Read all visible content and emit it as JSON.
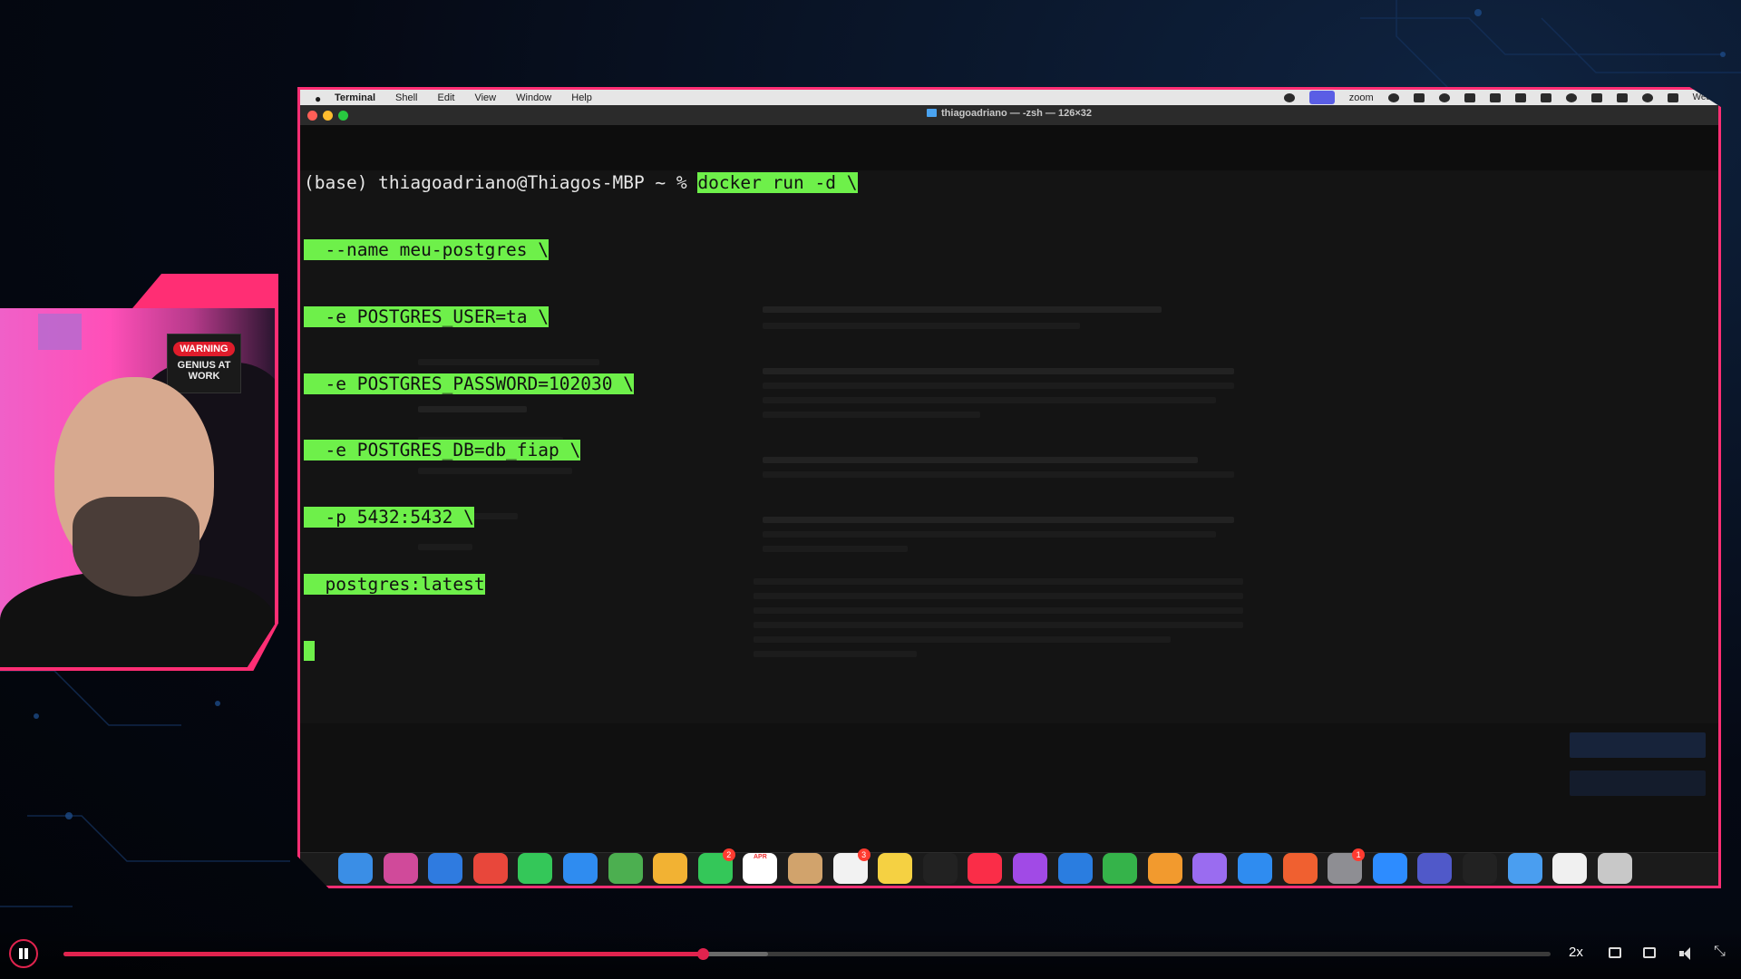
{
  "menubar": {
    "app_name": "Terminal",
    "menus": [
      "Shell",
      "Edit",
      "View",
      "Window",
      "Help"
    ],
    "zoom_label": "zoom",
    "date_fragment": "Wed"
  },
  "terminal": {
    "window_title": "thiagoadriano — -zsh — 126×32",
    "prompt": "(base) thiagoadriano@Thiagos-MBP ~ % ",
    "command_lines": [
      "docker run -d \\",
      "  --name meu-postgres \\",
      "  -e POSTGRES_USER=ta \\",
      "  -e POSTGRES_PASSWORD=102030 \\",
      "  -e POSTGRES_DB=db_fiap \\",
      "  -p 5432:5432 \\",
      "  postgres:latest"
    ]
  },
  "dock": {
    "apps": [
      "finder",
      "launchpad",
      "safari",
      "chrome",
      "messages",
      "mail",
      "maps",
      "photos",
      "facetime",
      "calendar",
      "contacts",
      "reminders",
      "notes",
      "tv",
      "music",
      "podcasts",
      "keynote",
      "numbers",
      "pages",
      "feather",
      "app-store",
      "toolbox",
      "system-settings",
      "zoom",
      "teams",
      "terminal",
      "downloads",
      "documents",
      "trash"
    ],
    "calendar_month": "APR",
    "badges": {
      "facetime": "2",
      "reminders": "3",
      "system-settings": "1"
    }
  },
  "webcam": {
    "poster_label": "WARNING",
    "poster_text": "GENIUS AT WORK"
  },
  "player": {
    "playback_speed": "2x",
    "progress_fraction": 0.43,
    "buffered_fraction": 0.474
  },
  "colors": {
    "frame_accent": "#ff2e74",
    "selection": "#6ef04a",
    "progress": "#e0234e"
  }
}
